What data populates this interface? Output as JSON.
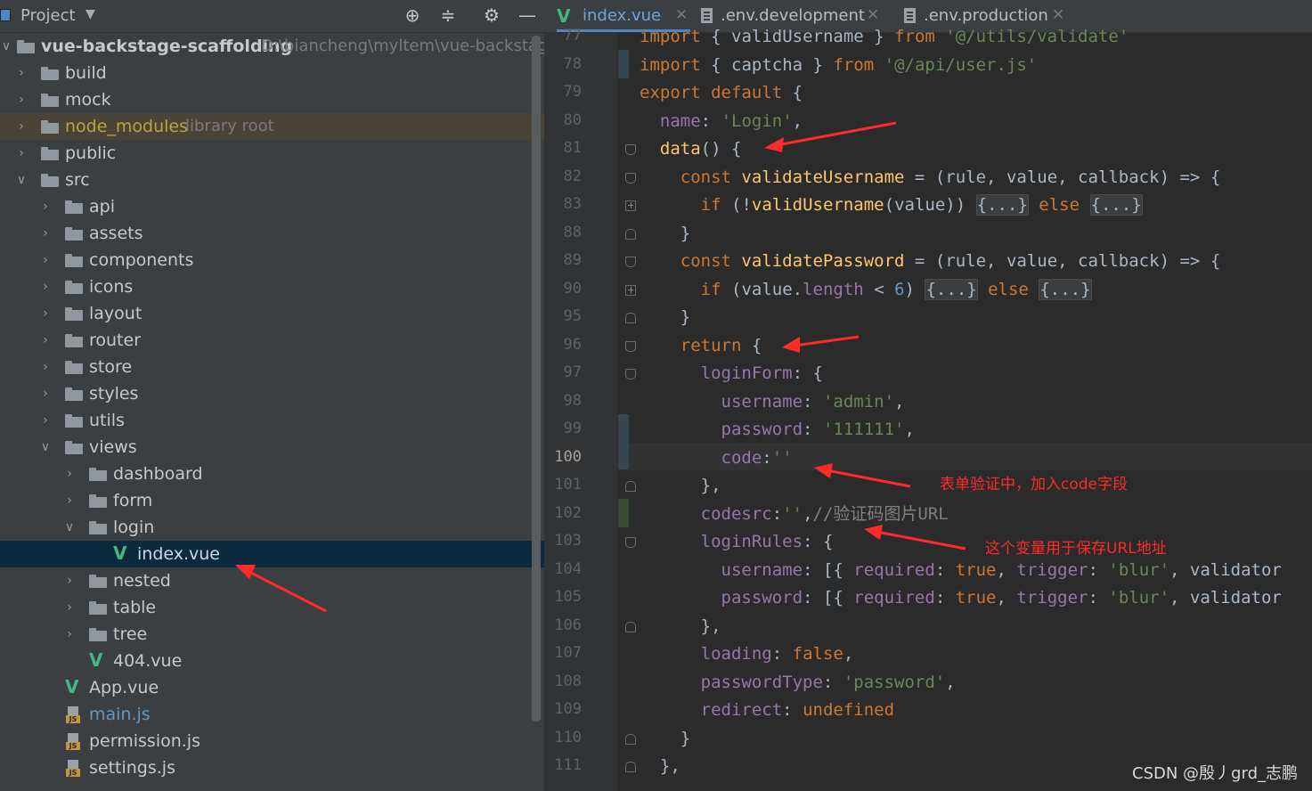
{
  "project_panel": {
    "title": "Project",
    "rows": [
      {
        "label": "vue-backstage-scaffolding",
        "sub": "D:\\biancheng\\myltem\\vue-backstage"
      },
      {
        "label": "build"
      },
      {
        "label": "mock"
      },
      {
        "label": "node_modules",
        "sub": "library root"
      },
      {
        "label": "public"
      },
      {
        "label": "src"
      },
      {
        "label": "api"
      },
      {
        "label": "assets"
      },
      {
        "label": "components"
      },
      {
        "label": "icons"
      },
      {
        "label": "layout"
      },
      {
        "label": "router"
      },
      {
        "label": "store"
      },
      {
        "label": "styles"
      },
      {
        "label": "utils"
      },
      {
        "label": "views"
      },
      {
        "label": "dashboard"
      },
      {
        "label": "form"
      },
      {
        "label": "login"
      },
      {
        "label": "index.vue"
      },
      {
        "label": "nested"
      },
      {
        "label": "table"
      },
      {
        "label": "tree"
      },
      {
        "label": "404.vue"
      },
      {
        "label": "App.vue"
      },
      {
        "label": "main.js"
      },
      {
        "label": "permission.js"
      },
      {
        "label": "settings.js"
      }
    ]
  },
  "editor": {
    "tabs": [
      {
        "label": "index.vue"
      },
      {
        "label": ".env.development"
      },
      {
        "label": ".env.production"
      }
    ],
    "lines": [
      {
        "n": "77",
        "text": "import { validUsername } from '@/utils/validate'"
      },
      {
        "n": "78",
        "text": "import { captcha } from '@/api/user.js'"
      },
      {
        "n": "79",
        "text": "export default {"
      },
      {
        "n": "80",
        "text": "  name: 'Login',"
      },
      {
        "n": "81",
        "text": "  data() {"
      },
      {
        "n": "82",
        "text": "    const validateUsername = (rule, value, callback) => {"
      },
      {
        "n": "83",
        "text": "      if (!validUsername(value)) {...} else {...}"
      },
      {
        "n": "88",
        "text": "    }"
      },
      {
        "n": "89",
        "text": "    const validatePassword = (rule, value, callback) => {"
      },
      {
        "n": "90",
        "text": "      if (value.length < 6) {...} else {...}"
      },
      {
        "n": "95",
        "text": "    }"
      },
      {
        "n": "96",
        "text": "    return {"
      },
      {
        "n": "97",
        "text": "      loginForm: {"
      },
      {
        "n": "98",
        "text": "        username: 'admin',"
      },
      {
        "n": "99",
        "text": "        password: '111111',"
      },
      {
        "n": "100",
        "text": "        code:''"
      },
      {
        "n": "101",
        "text": "      },"
      },
      {
        "n": "102",
        "text": "      codesrc:'',//验证码图片URL"
      },
      {
        "n": "103",
        "text": "      loginRules: {"
      },
      {
        "n": "104",
        "text": "        username: [{ required: true, trigger: 'blur', validator"
      },
      {
        "n": "105",
        "text": "        password: [{ required: true, trigger: 'blur', validator"
      },
      {
        "n": "106",
        "text": "      },"
      },
      {
        "n": "107",
        "text": "      loading: false,"
      },
      {
        "n": "108",
        "text": "      passwordType: 'password',"
      },
      {
        "n": "109",
        "text": "      redirect: undefined"
      },
      {
        "n": "110",
        "text": "    }"
      },
      {
        "n": "111",
        "text": "  },"
      }
    ]
  },
  "annotations": [
    {
      "text": "表单验证中，加入code字段"
    },
    {
      "text": "这个变量用于保存URL地址"
    }
  ],
  "watermark": "CSDN @殷丿grd_志鹏",
  "colors": {
    "accent": "#4a88c7",
    "annotation_red": "#ff2a2a",
    "vue_green": "#41b883"
  }
}
